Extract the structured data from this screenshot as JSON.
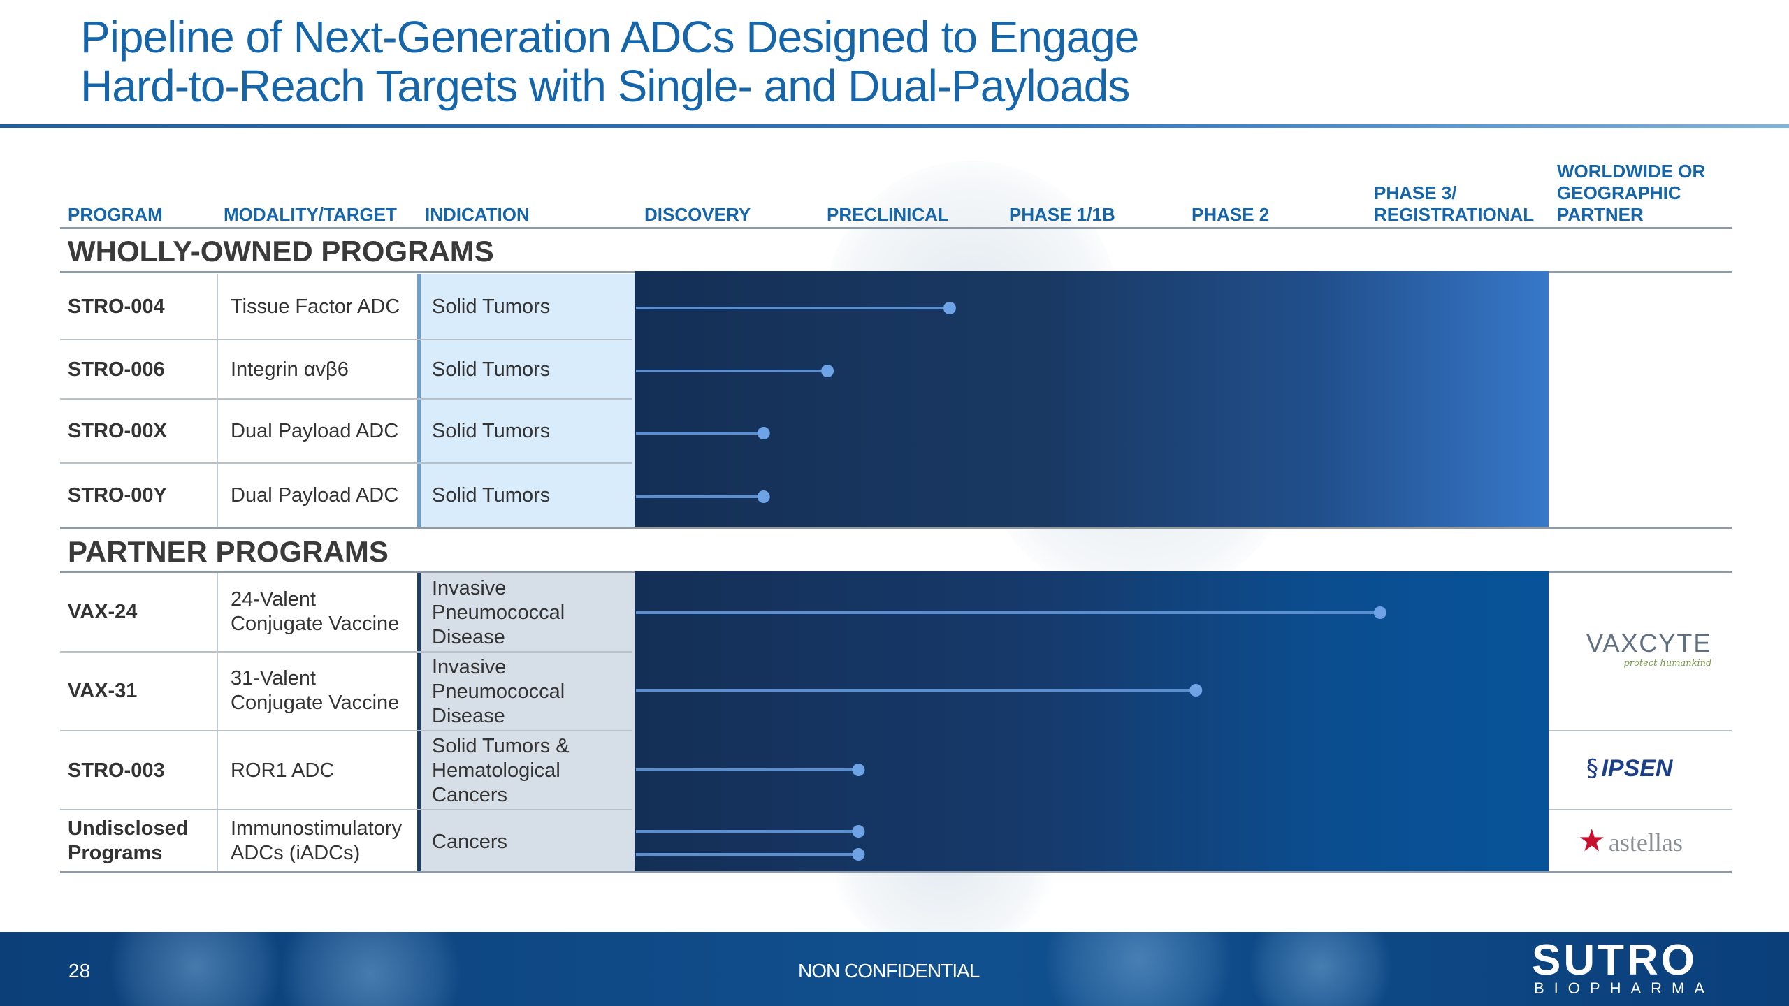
{
  "title_line1": "Pipeline of Next-Generation ADCs Designed to Engage",
  "title_line2": "Hard-to-Reach Targets with Single- and Dual-Payloads",
  "headers": {
    "program": "PROGRAM",
    "modality": "MODALITY/TARGET",
    "indication": "INDICATION",
    "discovery": "DISCOVERY",
    "preclinical": "PRECLINICAL",
    "phase1": "PHASE 1/1B",
    "phase2": "PHASE 2",
    "phase3_line1": "PHASE 3/",
    "phase3_line2": "REGISTRATIONAL",
    "partner_line1": "WORLDWIDE OR",
    "partner_line2": "GEOGRAPHIC",
    "partner_line3": "PARTNER"
  },
  "sections": {
    "wholly_owned": "WHOLLY-OWNED PROGRAMS",
    "partner": "PARTNER PROGRAMS"
  },
  "wholly_owned_rows": [
    {
      "program": "STRO-004",
      "modality": "Tissue Factor ADC",
      "indication": "Solid Tumors"
    },
    {
      "program": "STRO-006",
      "modality": "Integrin αvβ6",
      "indication": "Solid Tumors"
    },
    {
      "program": "STRO-00X",
      "modality": "Dual Payload ADC",
      "indication": "Solid Tumors"
    },
    {
      "program": "STRO-00Y",
      "modality": "Dual Payload ADC",
      "indication": "Solid Tumors"
    }
  ],
  "partner_rows": [
    {
      "program": "VAX-24",
      "modality_l1": "24-Valent",
      "modality_l2": "Conjugate Vaccine",
      "ind_l1": "Invasive",
      "ind_l2": "Pneumococcal",
      "ind_l3": "Disease"
    },
    {
      "program": "VAX-31",
      "modality_l1": "31-Valent",
      "modality_l2": "Conjugate Vaccine",
      "ind_l1": "Invasive",
      "ind_l2": "Pneumococcal",
      "ind_l3": "Disease"
    },
    {
      "program": "STRO-003",
      "modality": "ROR1 ADC",
      "ind_l1": "Solid Tumors &",
      "ind_l2": "Hematological",
      "ind_l3": "Cancers"
    },
    {
      "program_l1": "Undisclosed",
      "program_l2": "Programs",
      "modality_l1": "Immunostimulatory",
      "modality_l2": "ADCs (iADCs)",
      "indication": "Cancers"
    }
  ],
  "partners": {
    "vaxcyte": "VAXCYTE",
    "vaxcyte_tagline": "protect humankind",
    "ipsen": "IPSEN",
    "astellas": "astellas"
  },
  "footer": {
    "page": "28",
    "confidentiality": "NON CONFIDENTIAL",
    "brand": "SUTRO",
    "brand_sub": "BIOPHARMA"
  },
  "colors": {
    "title_blue": "#1565a8",
    "bar_line": "#5b8fd0",
    "bar_dot": "#6ea3e6"
  },
  "chart_data": {
    "type": "bar",
    "stages": [
      "DISCOVERY",
      "PRECLINICAL",
      "PHASE 1/1B",
      "PHASE 2",
      "PHASE 3/ REGISTRATIONAL"
    ],
    "value_units": "stages completed (0-5)",
    "series": [
      {
        "name": "STRO-004",
        "values": [
          1.72
        ]
      },
      {
        "name": "STRO-006",
        "values": [
          1.05
        ]
      },
      {
        "name": "STRO-00X",
        "values": [
          0.7
        ]
      },
      {
        "name": "STRO-00Y",
        "values": [
          0.7
        ]
      },
      {
        "name": "VAX-24",
        "values": [
          4.08
        ]
      },
      {
        "name": "VAX-31",
        "values": [
          3.07
        ]
      },
      {
        "name": "STRO-003",
        "values": [
          1.22
        ]
      },
      {
        "name": "Undisclosed Programs",
        "values": [
          1.22,
          1.22
        ]
      }
    ]
  }
}
